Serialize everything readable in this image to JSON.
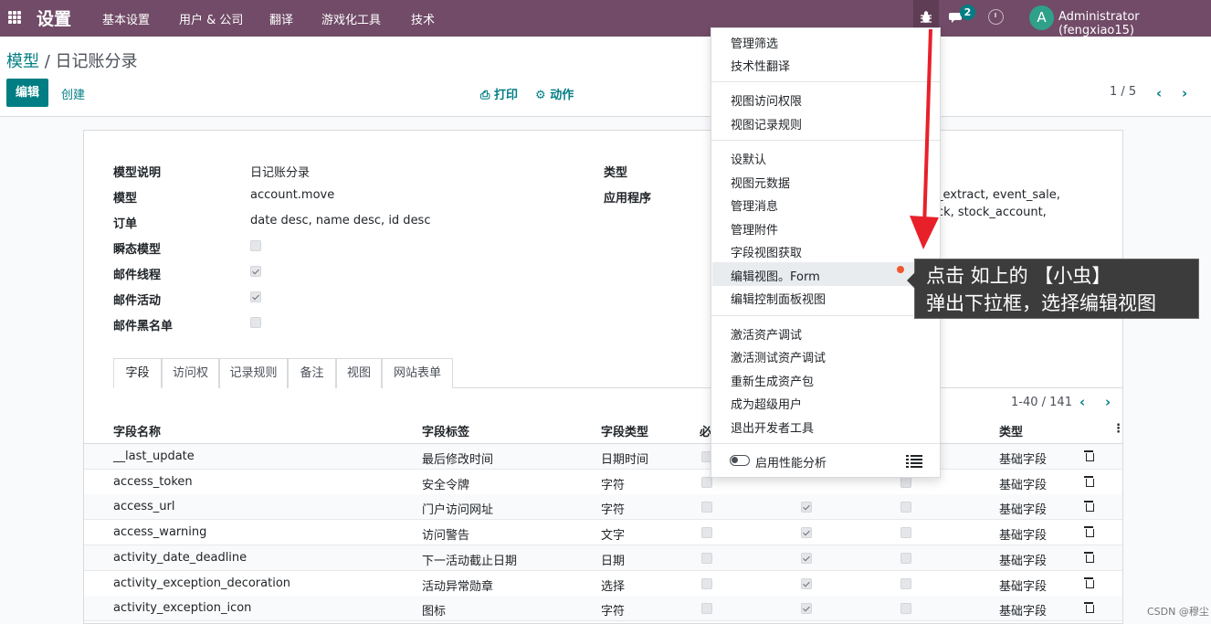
{
  "navbar": {
    "app_title": "设置",
    "menus": [
      "基本设置",
      "用户 & 公司",
      "翻译",
      "游戏化工具",
      "技术"
    ],
    "chat_badge": "2",
    "avatar_letter": "A",
    "user_name": "Administrator (fengxiao15)",
    "color": "#714b67"
  },
  "control_panel": {
    "breadcrumb_parent": "模型",
    "breadcrumb_sep": "/",
    "breadcrumb_current": "日记账分录",
    "edit_label": "编辑",
    "create_label": "创建",
    "print_label": "打印",
    "action_label": "动作",
    "pager": "1 / 5",
    "prev": "‹",
    "next": "›"
  },
  "form": {
    "fields": [
      {
        "label": "模型说明",
        "value": "日记账分录"
      },
      {
        "label": "模型",
        "value": "account.move"
      },
      {
        "label": "订单",
        "value": "date desc, name desc, id desc"
      },
      {
        "label": "瞬态模型",
        "checked": false
      },
      {
        "label": "邮件线程",
        "checked": true
      },
      {
        "label": "邮件活动",
        "checked": true
      },
      {
        "label": "邮件黑名单",
        "checked": false
      }
    ],
    "right_labels": [
      "类型",
      "应用程序"
    ],
    "app_values_line1": "e_extract, event_sale,",
    "app_values_line2": "ock, stock_account,"
  },
  "tabs": [
    "字段",
    "访问权",
    "记录规则",
    "备注",
    "视图",
    "网站表单"
  ],
  "sub_pager": "1-40 / 141",
  "table": {
    "headers": [
      "字段名称",
      "字段标签",
      "字段类型",
      "必",
      "类型"
    ],
    "rows": [
      {
        "name": "__last_update",
        "label": "最后修改时间",
        "type": "日期时间",
        "kind": "基础字段"
      },
      {
        "name": "access_token",
        "label": "安全令牌",
        "type": "字符",
        "kind": "基础字段"
      },
      {
        "name": "access_url",
        "label": "门户访问网址",
        "type": "字符",
        "kind": "基础字段"
      },
      {
        "name": "access_warning",
        "label": "访问警告",
        "type": "文字",
        "kind": "基础字段"
      },
      {
        "name": "activity_date_deadline",
        "label": "下一活动截止日期",
        "type": "日期",
        "kind": "基础字段"
      },
      {
        "name": "activity_exception_decoration",
        "label": "活动异常勋章",
        "type": "选择",
        "kind": "基础字段"
      },
      {
        "name": "activity_exception_icon",
        "label": "图标",
        "type": "字符",
        "kind": "基础字段"
      }
    ]
  },
  "debug_menu": {
    "items": [
      "管理筛选",
      "技术性翻译",
      "视图访问权限",
      "视图记录规则",
      "设默认",
      "视图元数据",
      "管理消息",
      "管理附件",
      "字段视图获取",
      "编辑视图。Form",
      "编辑控制面板视图",
      "激活资产调试",
      "激活测试资产调试",
      "重新生成资产包",
      "成为超级用户",
      "退出开发者工具"
    ],
    "profiling_label": "启用性能分析"
  },
  "annotation": {
    "line1": "点击 如上的 【小虫】",
    "line2": "弹出下拉框，选择编辑视图",
    "arrow_color": "#e8202a"
  },
  "watermark": "CSDN @穆尘"
}
